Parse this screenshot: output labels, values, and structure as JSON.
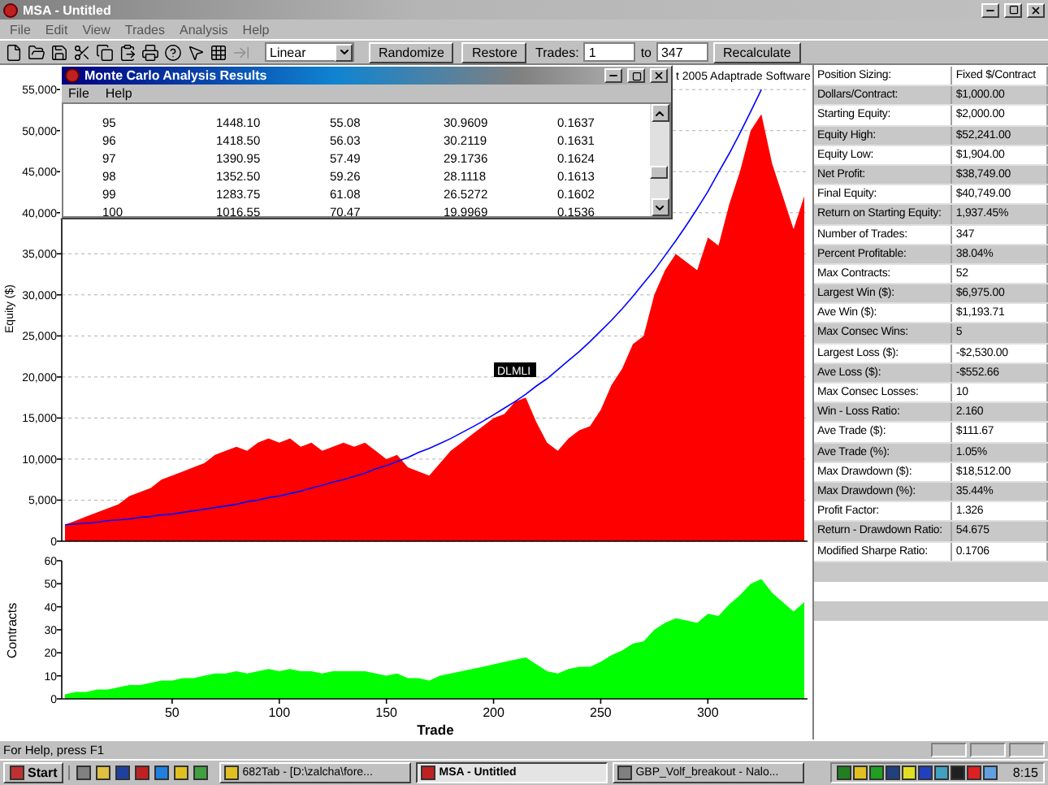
{
  "window": {
    "title": "MSA - Untitled"
  },
  "menu": [
    "File",
    "Edit",
    "View",
    "Trades",
    "Analysis",
    "Help"
  ],
  "toolbar": {
    "scale": "Linear",
    "buttons": [
      "Randomize",
      "Restore"
    ],
    "trades_label": "Trades:",
    "from": "1",
    "to_label": "to",
    "to": "347",
    "recalculate": "Recalculate"
  },
  "equity_chart": {
    "chart_data": {
      "type": "area",
      "title": "t 2005 Adaptrade Software",
      "ylabel": "Equity ($)",
      "grid": true,
      "series": [
        {
          "color": "#ff0000",
          "values": [
            2000,
            2500,
            3000,
            3500,
            4000,
            4500,
            5500,
            6000,
            6500,
            7500,
            8000,
            8500,
            9000,
            9500,
            10500,
            11000,
            11500,
            11000,
            12000,
            12500,
            12000,
            12500,
            11500,
            12000,
            11000,
            11500,
            12000,
            11500,
            12000,
            11000,
            10000,
            10500,
            9000,
            8500,
            8000,
            9500,
            11000,
            12000,
            13000,
            14000,
            15000,
            15500,
            17000,
            17500,
            14500,
            12000,
            11000,
            12500,
            13500,
            14000,
            16000,
            19000,
            21000,
            24000,
            25000,
            30000,
            33000,
            35000,
            34000,
            33000,
            37000,
            36000,
            41000,
            45000,
            50000,
            52000,
            46000,
            42000,
            38000,
            42000
          ]
        },
        {
          "type": "line",
          "color": "#0000ff",
          "values": [
            2000,
            2100,
            2200,
            2300,
            2500,
            2600,
            2700,
            2900,
            3000,
            3200,
            3300,
            3500,
            3700,
            3900,
            4100,
            4300,
            4500,
            4800,
            5000,
            5300,
            5500,
            5800,
            6100,
            6500,
            6800,
            7200,
            7500,
            7900,
            8300,
            8800,
            9200,
            9700,
            10200,
            10800,
            11300,
            11900,
            12500,
            13200,
            13900,
            14600,
            15400,
            16200,
            17000,
            17900,
            18900,
            19800,
            20900,
            22000,
            23100,
            24300,
            25600,
            26900,
            28300,
            29800,
            31400,
            33000,
            34800,
            36600,
            38500,
            40500,
            42600,
            44900,
            47200,
            49700,
            52300,
            55000,
            null,
            null,
            null,
            null
          ]
        }
      ],
      "ylim": [
        0,
        57000
      ],
      "yticks": [
        {
          "value": 0,
          "label": "0"
        },
        {
          "value": 5000,
          "label": "5,000"
        },
        {
          "value": 10000,
          "label": "10,000"
        },
        {
          "value": 15000,
          "label": "15,000"
        },
        {
          "value": 20000,
          "label": "20,000"
        },
        {
          "value": 25000,
          "label": "25,000"
        },
        {
          "value": 30000,
          "label": "30,000"
        },
        {
          "value": 35000,
          "label": "35,000"
        },
        {
          "value": 40000,
          "label": "40,000"
        },
        {
          "value": 45000,
          "label": "45,000"
        },
        {
          "value": 50000,
          "label": "50,000"
        },
        {
          "value": 55000,
          "label": "55,000"
        }
      ],
      "annotations": [
        "DLMLI"
      ]
    }
  },
  "contracts_chart": {
    "chart_data": {
      "type": "area",
      "xlabel": "Trade",
      "ylabel": "Contracts",
      "x": [
        0,
        5,
        10,
        15,
        20,
        25,
        30,
        35,
        40,
        45,
        50,
        55,
        60,
        65,
        70,
        75,
        80,
        85,
        90,
        95,
        100,
        105,
        110,
        115,
        120,
        125,
        130,
        135,
        140,
        145,
        150,
        155,
        160,
        165,
        170,
        175,
        180,
        185,
        190,
        195,
        200,
        205,
        210,
        215,
        220,
        225,
        230,
        235,
        240,
        245,
        250,
        255,
        260,
        265,
        270,
        275,
        280,
        285,
        290,
        295,
        300,
        305,
        310,
        315,
        320,
        325,
        330,
        335,
        340,
        345
      ],
      "xlim": [
        0,
        345
      ],
      "series": [
        {
          "color": "#00ff00",
          "values": [
            2,
            3,
            3,
            4,
            4,
            5,
            6,
            6,
            7,
            8,
            8,
            9,
            9,
            10,
            11,
            11,
            12,
            11,
            12,
            13,
            12,
            13,
            12,
            12,
            11,
            12,
            12,
            12,
            12,
            11,
            10,
            11,
            9,
            9,
            8,
            10,
            11,
            12,
            13,
            14,
            15,
            16,
            17,
            18,
            15,
            12,
            11,
            13,
            14,
            14,
            16,
            19,
            21,
            24,
            25,
            30,
            33,
            35,
            34,
            33,
            37,
            36,
            41,
            45,
            50,
            52,
            46,
            42,
            38,
            42
          ]
        }
      ],
      "ylim": [
        0,
        60
      ],
      "yticks": [
        0,
        10,
        20,
        30,
        40,
        50,
        60
      ],
      "xticks": [
        50,
        100,
        150,
        200,
        250,
        300
      ]
    }
  },
  "mc_window": {
    "title": "Monte Carlo Analysis Results",
    "menu": [
      "File",
      "Help"
    ],
    "rows": [
      [
        "95",
        "1448.10",
        "55.08",
        "30.9609",
        "0.1637"
      ],
      [
        "96",
        "1418.50",
        "56.03",
        "30.2119",
        "0.1631"
      ],
      [
        "97",
        "1390.95",
        "57.49",
        "29.1736",
        "0.1624"
      ],
      [
        "98",
        "1352.50",
        "59.26",
        "28.1118",
        "0.1613"
      ],
      [
        "99",
        "1283.75",
        "61.08",
        "26.5272",
        "0.1602"
      ],
      [
        "100",
        "1016.55",
        "70.47",
        "19.9969",
        "0.1536"
      ]
    ]
  },
  "stats": [
    {
      "label": "Position Sizing:",
      "value": "Fixed $/Contract"
    },
    {
      "label": "Dollars/Contract:",
      "value": "$1,000.00"
    },
    {
      "label": "Starting Equity:",
      "value": "$2,000.00"
    },
    {
      "label": "Equity High:",
      "value": "$52,241.00"
    },
    {
      "label": "Equity Low:",
      "value": "$1,904.00"
    },
    {
      "label": "Net Profit:",
      "value": "$38,749.00"
    },
    {
      "label": "Final Equity:",
      "value": "$40,749.00"
    },
    {
      "label": "Return on Starting Equity:",
      "value": "1,937.45%"
    },
    {
      "label": "Number of Trades:",
      "value": "347"
    },
    {
      "label": "Percent Profitable:",
      "value": "38.04%"
    },
    {
      "label": "Max Contracts:",
      "value": "52"
    },
    {
      "label": "Largest Win ($):",
      "value": "$6,975.00"
    },
    {
      "label": "Ave Win ($):",
      "value": "$1,193.71"
    },
    {
      "label": "Max Consec Wins:",
      "value": "5"
    },
    {
      "label": "Largest Loss ($):",
      "value": "-$2,530.00"
    },
    {
      "label": "Ave Loss ($):",
      "value": "-$552.66"
    },
    {
      "label": "Max Consec Losses:",
      "value": "10"
    },
    {
      "label": "Win - Loss Ratio:",
      "value": "2.160"
    },
    {
      "label": "Ave Trade ($):",
      "value": "$111.67"
    },
    {
      "label": "Ave Trade (%):",
      "value": "1.05%"
    },
    {
      "label": "Max Drawdown ($):",
      "value": "$18,512.00"
    },
    {
      "label": "Max Drawdown (%):",
      "value": "35.44%"
    },
    {
      "label": "Profit Factor:",
      "value": "1.326"
    },
    {
      "label": "Return - Drawdown Ratio:",
      "value": "54.675"
    },
    {
      "label": "Modified Sharpe Ratio:",
      "value": "0.1706"
    }
  ],
  "status_bar": {
    "text": "For Help, press F1"
  },
  "taskbar": {
    "start": "Start",
    "tasks": [
      {
        "label": "682Tab - [D:\\zalcha\\fore...",
        "selected": false
      },
      {
        "label": "MSA - Untitled",
        "selected": true
      },
      {
        "label": "GBP_Volf_breakout - Nalo...",
        "selected": false
      }
    ],
    "clock": "8:15"
  }
}
